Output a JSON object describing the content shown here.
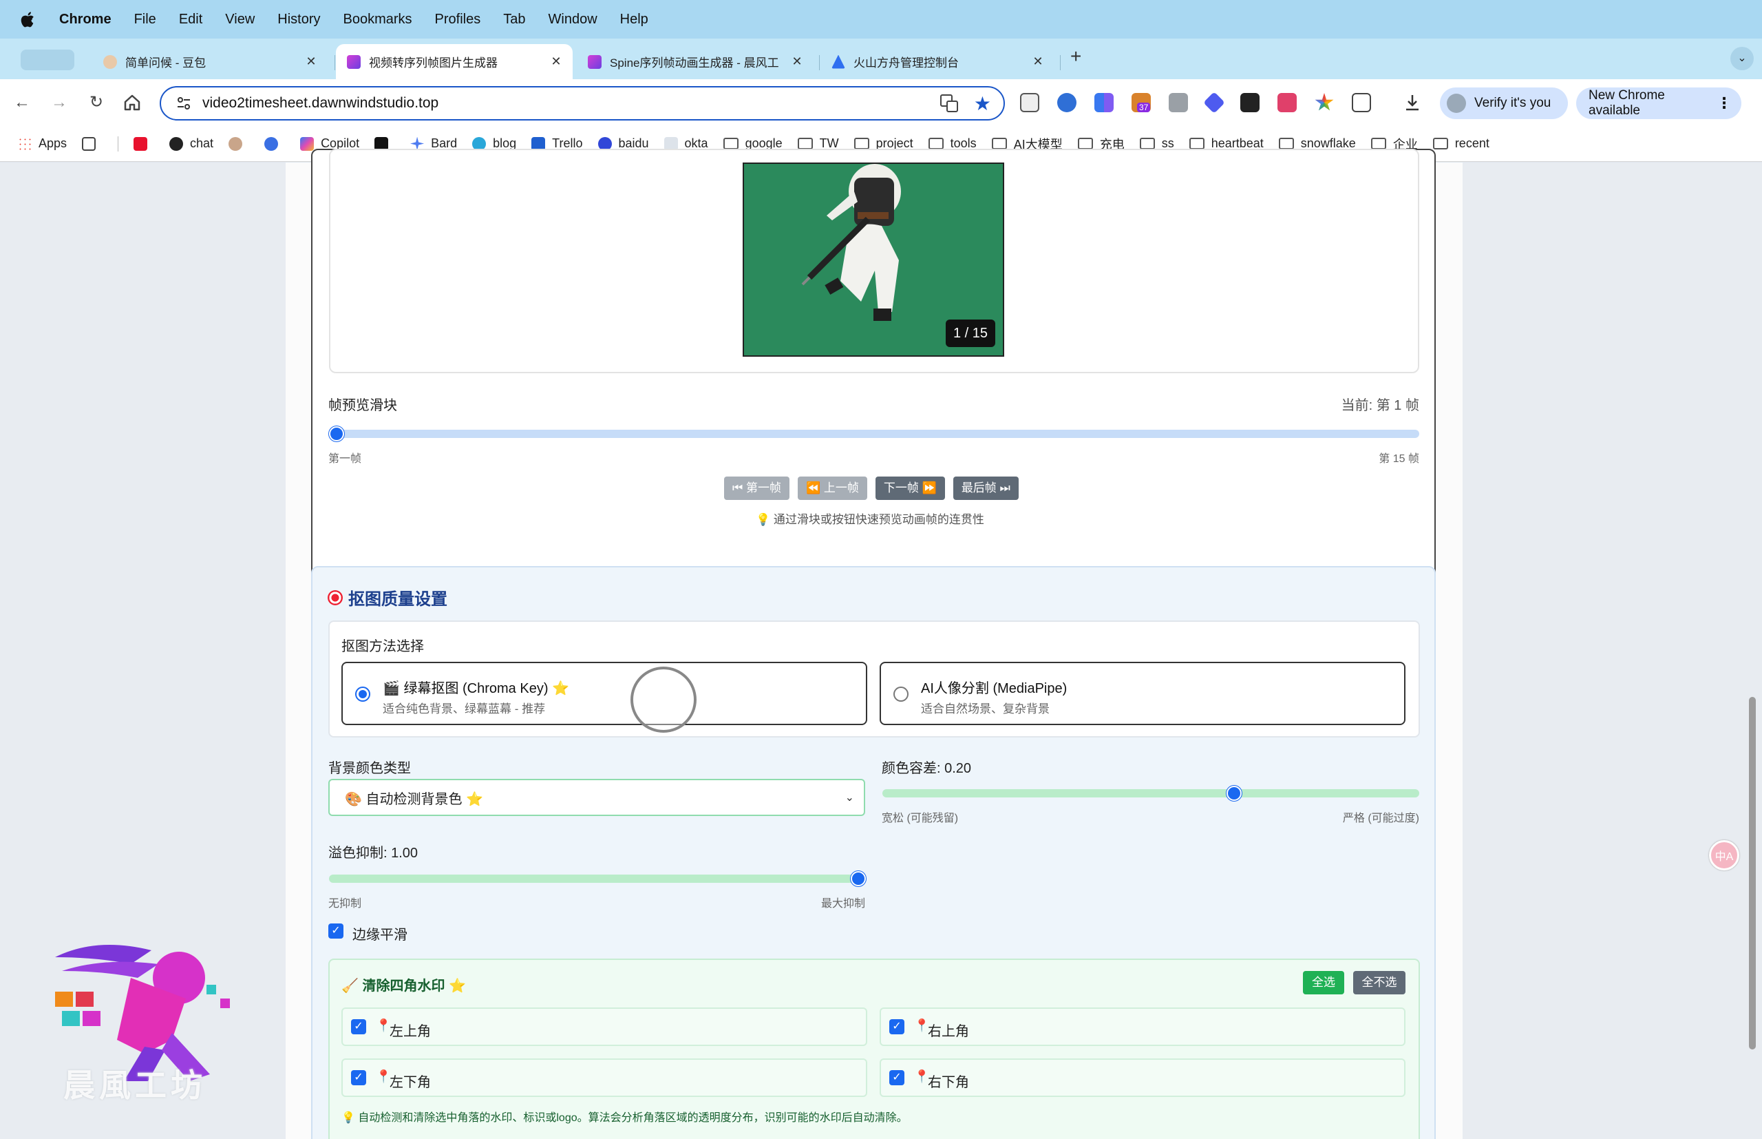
{
  "menubar": {
    "app": "Chrome",
    "items": [
      "File",
      "Edit",
      "View",
      "History",
      "Bookmarks",
      "Profiles",
      "Tab",
      "Window",
      "Help"
    ]
  },
  "tabs": [
    {
      "title": "简单问候 - 豆包",
      "active": false
    },
    {
      "title": "视频转序列帧图片生成器",
      "active": true
    },
    {
      "title": "Spine序列帧动画生成器 - 晨风工",
      "active": false
    },
    {
      "title": "火山方舟管理控制台",
      "active": false
    }
  ],
  "toolbar": {
    "url": "video2timesheet.dawnwindstudio.top",
    "verify_label": "Verify it's you",
    "update_label": "New Chrome available",
    "ext_badge": "37"
  },
  "bookmarks": [
    "Apps",
    "chat",
    "Copilot",
    "Bard",
    "blog",
    "Trello",
    "baidu",
    "okta",
    "google",
    "TW",
    "project",
    "tools",
    "AI大模型",
    "充电",
    "ss",
    "heartbeat",
    "snowflake",
    "企业",
    "recent"
  ],
  "preview": {
    "counter": "1 / 15",
    "slider_title": "帧预览滑块",
    "current": "当前: 第 1 帧",
    "first_label": "第一帧",
    "last_label": "第 15 帧",
    "slider_value": 0,
    "buttons": [
      "⏮ 第一帧",
      "⏪ 上一帧",
      "下一帧 ⏩",
      "最后帧 ⏭"
    ],
    "hint": "💡 通过滑块或按钮快速预览动画帧的连贯性"
  },
  "quality": {
    "title": "抠图质量设置",
    "method_label": "抠图方法选择",
    "options": [
      {
        "title": "🎬 绿幕抠图 (Chroma Key) ⭐",
        "desc": "适合纯色背景、绿幕蓝幕 - 推荐",
        "selected": true
      },
      {
        "title": "AI人像分割 (MediaPipe)",
        "desc": "适合自然场景、复杂背景",
        "selected": false
      }
    ],
    "bg_type_label": "背景颜色类型",
    "bg_type_value": "🎨 自动检测背景色 ⭐",
    "tolerance_label": "颜色容差: 0.20",
    "tolerance_value": 0.2,
    "tolerance_min": "宽松 (可能残留)",
    "tolerance_max": "严格 (可能过度)",
    "spill_label": "溢色抑制: 1.00",
    "spill_value": 1.0,
    "spill_min": "无抑制",
    "spill_max": "最大抑制",
    "smooth_label": "边缘平滑",
    "smooth_checked": true
  },
  "watermark": {
    "title": "🧹 清除四角水印 ⭐",
    "select_all": "全选",
    "select_none": "全不选",
    "corners": [
      "左上角",
      "右上角",
      "左下角",
      "右下角"
    ],
    "hint": "💡 自动检测和清除选中角落的水印、标识或logo。算法会分析角落区域的透明度分布，识别可能的水印后自动清除。"
  },
  "float_translate": "中A",
  "logo_text": "晨風工坊",
  "colors": {
    "accent": "#1a68f0",
    "menubar": "#a9d8f2",
    "tabstrip": "#c2e6f7",
    "green_screen": "#2b8a5c",
    "success": "#1fb155"
  }
}
